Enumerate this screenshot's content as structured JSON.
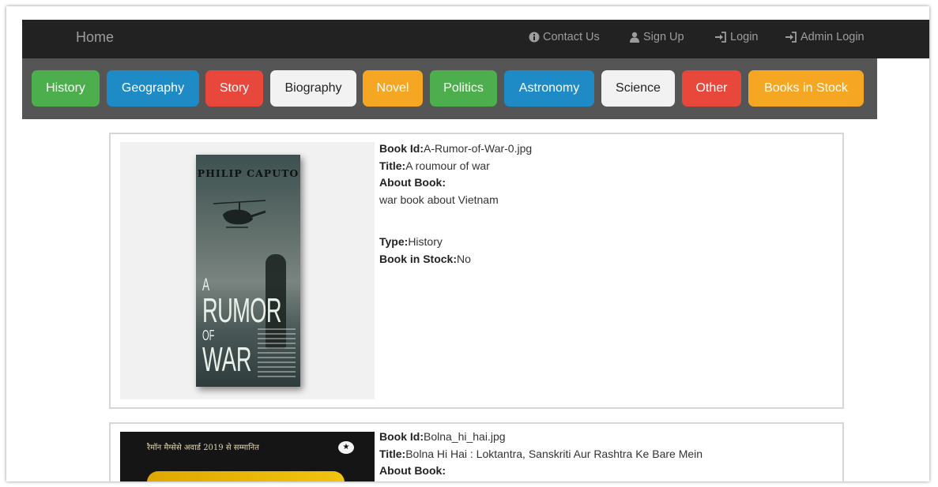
{
  "navbar": {
    "brand": "Home",
    "links": [
      {
        "label": "Contact Us",
        "icon": "info-circle-icon"
      },
      {
        "label": "Sign Up",
        "icon": "user-icon"
      },
      {
        "label": "Login",
        "icon": "login-icon"
      },
      {
        "label": "Admin Login",
        "icon": "login-icon"
      }
    ]
  },
  "categories": [
    {
      "label": "History",
      "color": "#4cae4c"
    },
    {
      "label": "Geography",
      "color": "#1f8bc6"
    },
    {
      "label": "Story",
      "color": "#e8473c"
    },
    {
      "label": "Biography",
      "color": "#f2f2f2"
    },
    {
      "label": "Novel",
      "color": "#f5a623"
    },
    {
      "label": "Politics",
      "color": "#4cae4c"
    },
    {
      "label": "Astronomy",
      "color": "#1f8bc6"
    },
    {
      "label": "Science",
      "color": "#f2f2f2"
    },
    {
      "label": "Other",
      "color": "#e8473c"
    },
    {
      "label": "Books in Stock",
      "color": "#f5a623"
    }
  ],
  "books": [
    {
      "cover": {
        "author": "PHILIP CAPUTO",
        "title_a": "A",
        "title_rumor": "RUMOR",
        "title_of": "OF",
        "title_war": "WAR"
      },
      "id_label": "Book Id:",
      "id": "A-Rumor-of-War-0.jpg",
      "title_label": "Title:",
      "title": "A roumour of war",
      "about_label": "About Book:",
      "about": "war book about Vietnam",
      "type_label": "Type:",
      "type": "History",
      "stock_label": "Book in Stock:",
      "stock": "No"
    },
    {
      "cover": {
        "tagline": "रैमॉन मैग्सेसे अवार्ड 2019 से सम्मानित"
      },
      "id_label": "Book Id:",
      "id": "Bolna_hi_hai.jpg",
      "title_label": "Title:",
      "title": "Bolna Hi Hai : Loktantra, Sanskriti Aur Rashtra Ke Bare Mein",
      "about_label": "About Book:"
    }
  ]
}
